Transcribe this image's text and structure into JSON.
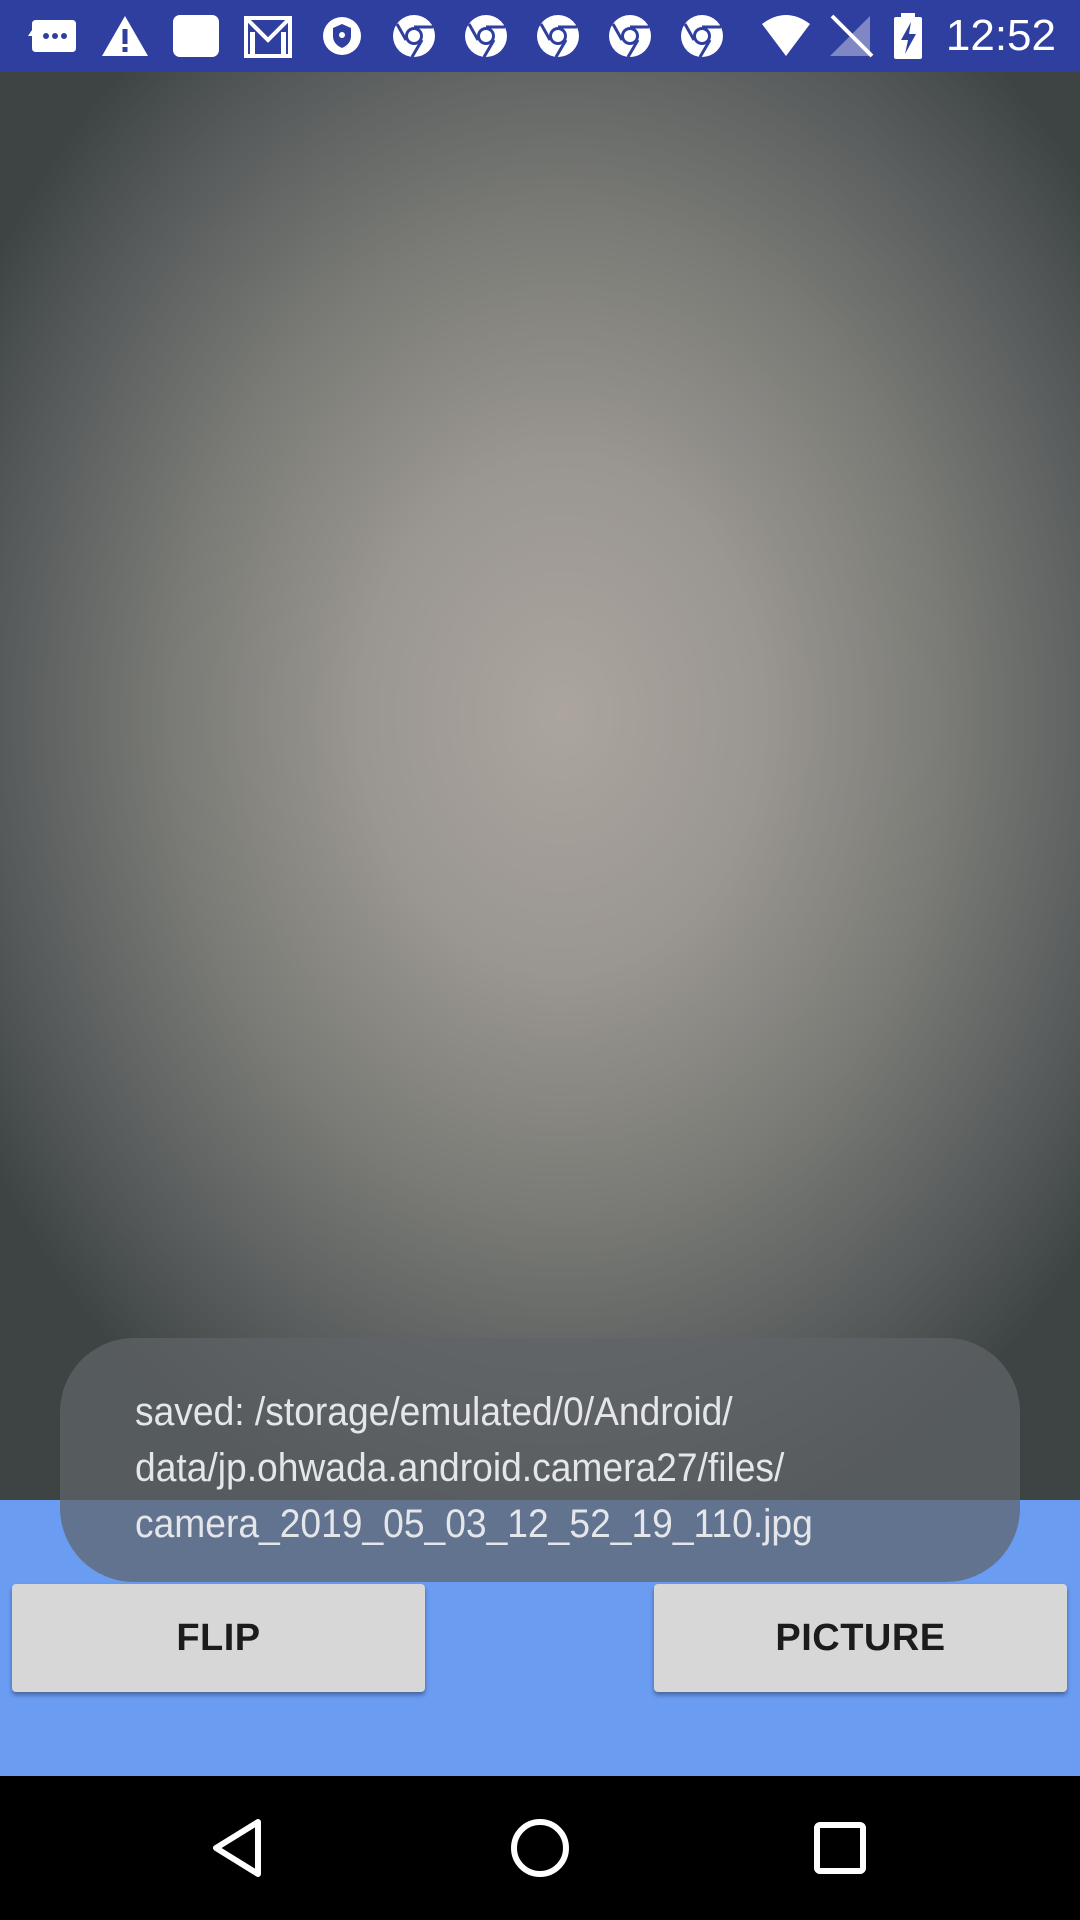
{
  "status_bar": {
    "time": "12:52",
    "icons": [
      "message-icon",
      "warning-icon",
      "square-notification-icon",
      "gmail-icon",
      "vpn-shield-icon",
      "chrome-icon",
      "chrome-icon",
      "chrome-icon",
      "chrome-icon",
      "chrome-icon",
      "wifi-icon",
      "no-signal-icon",
      "battery-charging-icon"
    ]
  },
  "toast": {
    "lines": [
      "saved: /storage/emulated/0/Android/",
      "data/jp.ohwada.android.camera27/files/",
      "camera_2019_05_03_12_52_19_110.jpg"
    ]
  },
  "buttons": {
    "flip_label": "FLIP",
    "picture_label": "PICTURE"
  },
  "nav_bar": {
    "icons": [
      "back-icon",
      "home-icon",
      "recents-icon"
    ]
  },
  "colors": {
    "status_bar": "#2f3f9f",
    "controls_background": "#6a9cf2",
    "button_background": "#d7d7d7",
    "nav_bar": "#000000"
  }
}
